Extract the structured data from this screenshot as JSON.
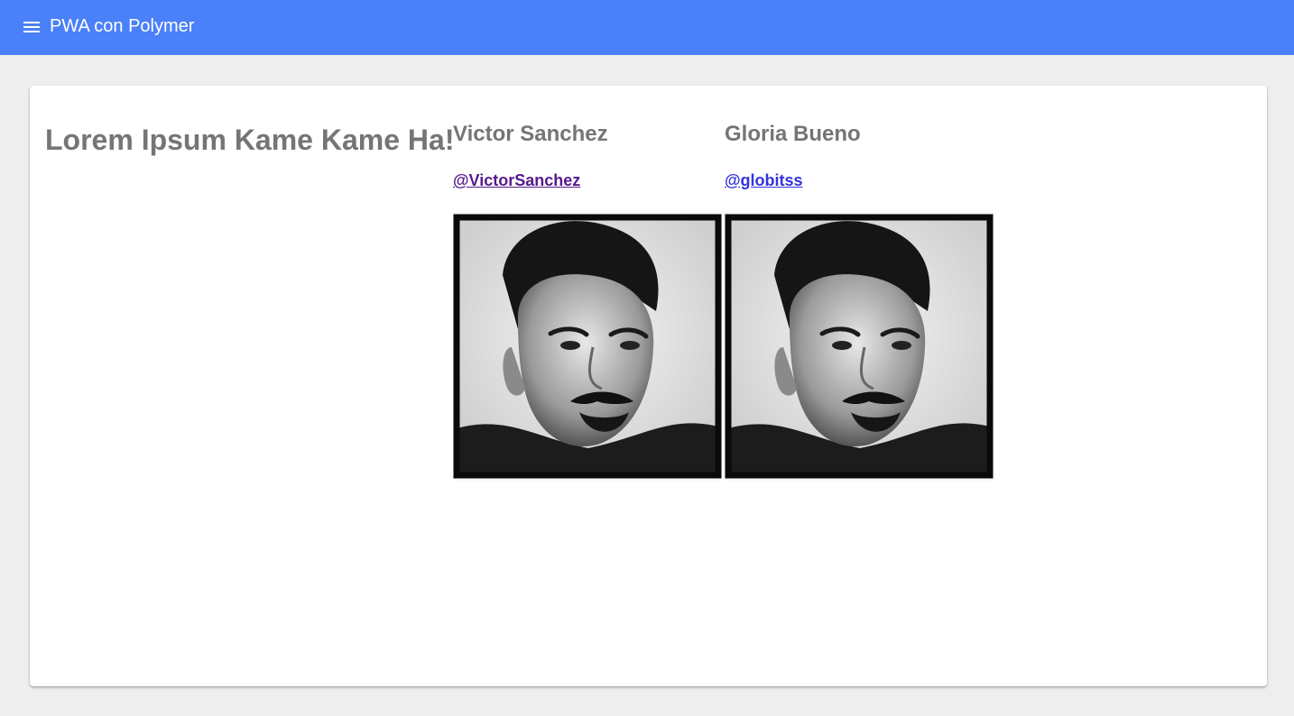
{
  "app": {
    "title": "PWA con Polymer"
  },
  "main": {
    "headline": "Lorem Ipsum Kame Kame Ha!"
  },
  "profiles": [
    {
      "name": "Victor Sanchez",
      "handle": "@VictorSanchez",
      "handle_color": "#551a8b"
    },
    {
      "name": "Gloria Bueno",
      "handle": "@globitss",
      "handle_color": "#3333dd"
    }
  ],
  "colors": {
    "toolbar": "#4a80f8",
    "background": "#eeeeee",
    "heading_text": "#757575"
  },
  "icons": {
    "menu": "menu-icon"
  }
}
